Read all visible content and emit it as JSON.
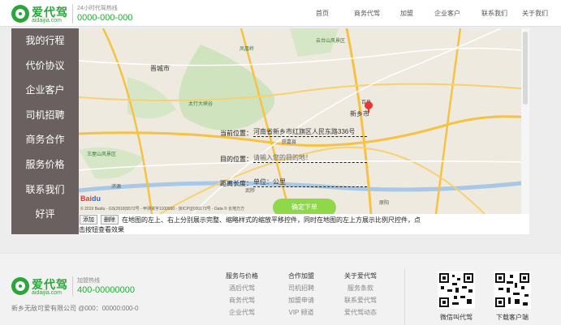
{
  "header": {
    "logo_name": "爱代驾",
    "logo_sub": "aidaijia.com",
    "hotline_label": "24小时代驾热线",
    "hotline_number": "0000-000-000",
    "nav": [
      {
        "label": "首页"
      },
      {
        "label": "商务代驾"
      },
      {
        "label": "加盟"
      },
      {
        "label": "企业客户"
      },
      {
        "label": "联系我们"
      },
      {
        "label": "关于我们"
      }
    ]
  },
  "sidebar": {
    "items": [
      {
        "label": "我的行程"
      },
      {
        "label": "代价协议"
      },
      {
        "label": "企业客户"
      },
      {
        "label": "司机招聘"
      },
      {
        "label": "商务合作"
      },
      {
        "label": "服务价格"
      },
      {
        "label": "联系我们"
      },
      {
        "label": "好评"
      }
    ]
  },
  "map": {
    "places": {
      "jiaozuo": "焦作市",
      "xinxiang": "新乡市",
      "jincheng": "晋城市",
      "yuntai": "云台山风景区",
      "taihang": "太行大峡谷",
      "wangwu": "王屋山风景区",
      "fenghuang": "凤凰岭",
      "baiquan": "百泉",
      "jiyuan": "济源",
      "wuzhi": "武陟",
      "huojia": "获嘉县",
      "yuanyang": "原阳"
    },
    "form": {
      "current_label": "当前位置：",
      "current_value": "河南省新乡市红旗区人民东路336号",
      "dest_label": "目的位置：",
      "dest_placeholder": "请输入您的目的地！",
      "distance_label": "距离长度：",
      "distance_value": "单位：公里"
    },
    "confirm_label": "确定下单",
    "baidu_logo": "Bai",
    "baidu_paw": "du",
    "copyright": "© 2019 Baidu - GS(2018)5572号 - 甲测资字1100930 - 京ICP证030173号 - Data © 长地万方"
  },
  "tools": {
    "add_label": "添加",
    "delete_label": "删除",
    "desc_line1": "在地图的左上、右上分别展示完整、缩略样式的缩放平移控件，同时在地图的左上方展示比例尺控件，点",
    "desc_line2": "击按钮查看效果"
  },
  "footer": {
    "logo_name": "爱代驾",
    "logo_sub": "aidaijia.com",
    "hotline_label": "加盟热线",
    "hotline_number": "400-00000000",
    "company": "新乡无敌可爱有限公司 @000：00000:000-0",
    "columns": [
      {
        "title": "服务与价格",
        "items": [
          "酒后代驾",
          "商务代驾",
          "企业代驾"
        ]
      },
      {
        "title": "合作加盟",
        "items": [
          "司机招聘",
          "加盟申请",
          "VIP 频道"
        ]
      },
      {
        "title": "关于爱代驾",
        "items": [
          "服务条款",
          "联系爱代驾",
          "爱代驾动态"
        ]
      }
    ],
    "qr_wechat_label": "微信叫代驾",
    "qr_app_label": "下载客户端"
  },
  "colors": {
    "brand_green": "#2aa63a",
    "sidebar_bg": "#6b6060",
    "confirm_button": "#8fd84a"
  }
}
